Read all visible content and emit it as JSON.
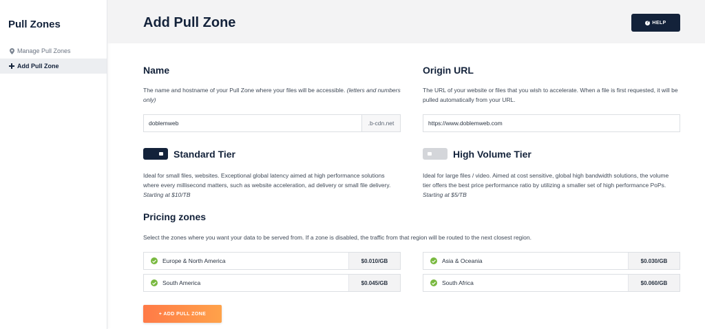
{
  "sidebar": {
    "title": "Pull Zones",
    "items": [
      {
        "label": "Manage Pull Zones",
        "icon": "map-pin-icon"
      },
      {
        "label": "Add Pull Zone",
        "icon": "plus-icon"
      }
    ]
  },
  "header": {
    "title": "Add Pull Zone",
    "help_label": "HELP"
  },
  "name_section": {
    "title": "Name",
    "description": "The name and hostname of your Pull Zone where your files will be accessible.",
    "description_note": "(letters and numbers only)",
    "input_value": "doblemweb",
    "suffix": ".b-cdn.net"
  },
  "origin_section": {
    "title": "Origin URL",
    "description": "The URL of your website or files that you wish to accelerate. When a file is first requested, it will be pulled automatically from your URL.",
    "input_value": "https://www.doblemweb.com"
  },
  "tiers": {
    "standard": {
      "title": "Standard Tier",
      "enabled": true,
      "description": "Ideal for small files, websites. Exceptional global latency aimed at high performance solutions where every millisecond matters, such as website acceleration, ad delivery or small file delivery.",
      "price_note": "Starting at $10/TB"
    },
    "high_volume": {
      "title": "High Volume Tier",
      "enabled": false,
      "description": "Ideal for large files / video. Aimed at cost sensitive, global high bandwidth solutions, the volume tier offers the best price performance ratio by utilizing a smaller set of high performance PoPs.",
      "price_note": "Starting at $5/TB"
    }
  },
  "pricing": {
    "title": "Pricing zones",
    "description": "Select the zones where you want your data to be served from. If a zone is disabled, the traffic from that region will be routed to the next closest region.",
    "zones": [
      {
        "name": "Europe & North America",
        "price": "$0.010/GB",
        "enabled": true
      },
      {
        "name": "Asia & Oceania",
        "price": "$0.030/GB",
        "enabled": true
      },
      {
        "name": "South America",
        "price": "$0.045/GB",
        "enabled": true
      },
      {
        "name": "South Africa",
        "price": "$0.060/GB",
        "enabled": true
      }
    ]
  },
  "submit": {
    "label": "+ ADD PULL ZONE"
  },
  "colors": {
    "navy": "#13223a",
    "accent_orange": "#ff8a48",
    "check_green": "#79b940"
  }
}
